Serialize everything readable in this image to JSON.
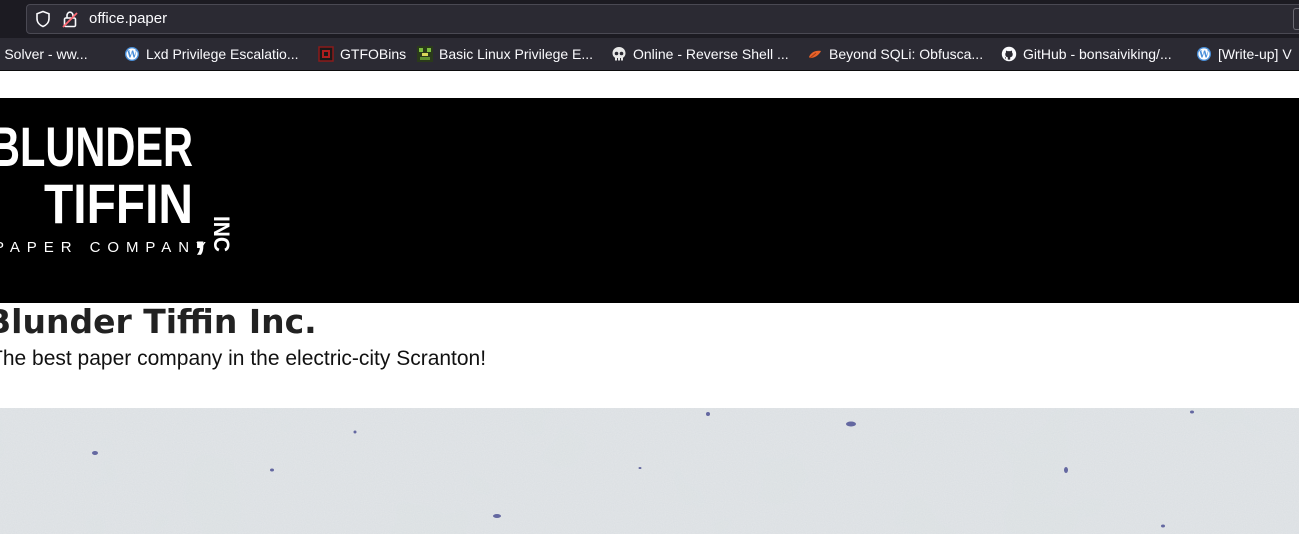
{
  "browser": {
    "url": "office.paper",
    "bookmarks": [
      {
        "label": "re Solver - ww...",
        "icon": "none"
      },
      {
        "label": "Lxd Privilege Escalatio...",
        "icon": "wordpress-icon"
      },
      {
        "label": "GTFOBins",
        "icon": "gtfobins-icon"
      },
      {
        "label": "Basic Linux Privilege E...",
        "icon": "pixel-icon"
      },
      {
        "label": "Online - Reverse Shell ...",
        "icon": "skull-icon"
      },
      {
        "label": "Beyond SQLi: Obfusca...",
        "icon": "orange-leaf-icon"
      },
      {
        "label": "GitHub - bonsaiviking/...",
        "icon": "github-icon"
      },
      {
        "label": "[Write-up] V",
        "icon": "wordpress-icon"
      }
    ]
  },
  "header": {
    "logo": {
      "line1": "BLUNDER",
      "line2": "TIFFIN",
      "inc": "INC",
      "comma": ",",
      "line3": "PAPER COMPANY"
    }
  },
  "main": {
    "title": "Blunder Tiffin Inc.",
    "tagline": "The best paper company in the electric-city Scranton!"
  },
  "colors": {
    "chrome_bg": "#1c1b22",
    "toolbar_bg": "#2b2a33",
    "banner_bg": "#000000",
    "paper_bg": "#dfe3e4"
  }
}
